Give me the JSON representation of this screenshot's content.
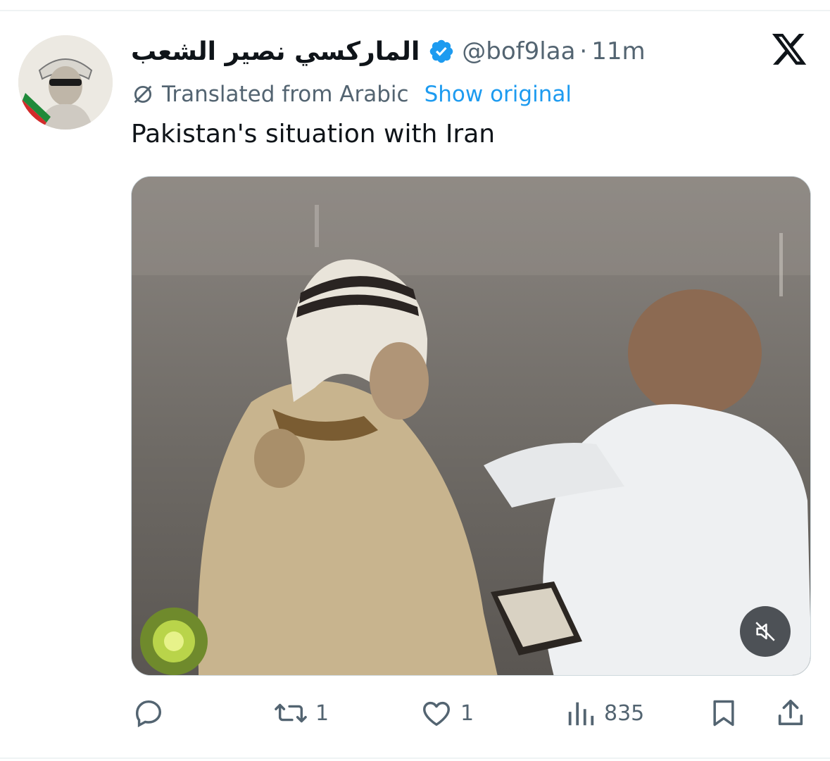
{
  "tweet": {
    "display_name": "الماركسي نصير الشعب",
    "handle": "@bof9laa",
    "separator": "·",
    "time": "11m",
    "translation_label": "Translated from Arabic",
    "show_original_label": "Show original",
    "text": "Pakistan's situation with Iran"
  },
  "actions": {
    "replies": "",
    "reposts": "1",
    "likes": "1",
    "views": "835"
  },
  "icons": {
    "verified": "verified-badge-icon",
    "x_logo": "x-logo-icon",
    "translate": "translate-icon",
    "reply": "reply-icon",
    "repost": "repost-icon",
    "like": "heart-icon",
    "views": "views-chart-icon",
    "bookmark": "bookmark-icon",
    "share": "share-icon",
    "mute": "muted-speaker-icon"
  },
  "colors": {
    "accent": "#1d9bf0",
    "text_primary": "#0f1419",
    "text_secondary": "#536471"
  }
}
